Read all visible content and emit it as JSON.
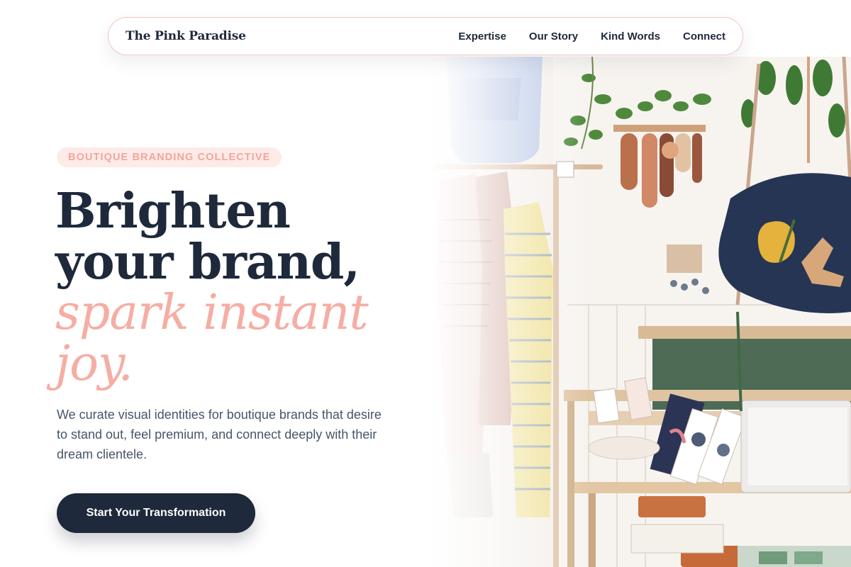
{
  "nav": {
    "brand": "The Pink Paradise",
    "links": [
      {
        "label": "Expertise"
      },
      {
        "label": "Our Story"
      },
      {
        "label": "Kind Words"
      },
      {
        "label": "Connect"
      }
    ]
  },
  "hero": {
    "eyebrow": "BOUTIQUE BRANDING COLLECTIVE",
    "headline_line1": "Brighten",
    "headline_line2": "your brand,",
    "headline_accent_line1": "spark instant",
    "headline_accent_line2": "joy.",
    "description": "We curate visual identities for boutique brands that desire to stand out, feel premium, and connect deeply with their dream clientele.",
    "cta_label": "Start Your Transformation",
    "image_alt": "Boutique shop interior with clothing rack, plants and handbags"
  },
  "colors": {
    "navy": "#1e293b",
    "pink_accent": "#f6ada3",
    "pink_pill_bg": "#fdebe8",
    "body_text": "#475569",
    "nav_border": "#f3c6c0"
  }
}
